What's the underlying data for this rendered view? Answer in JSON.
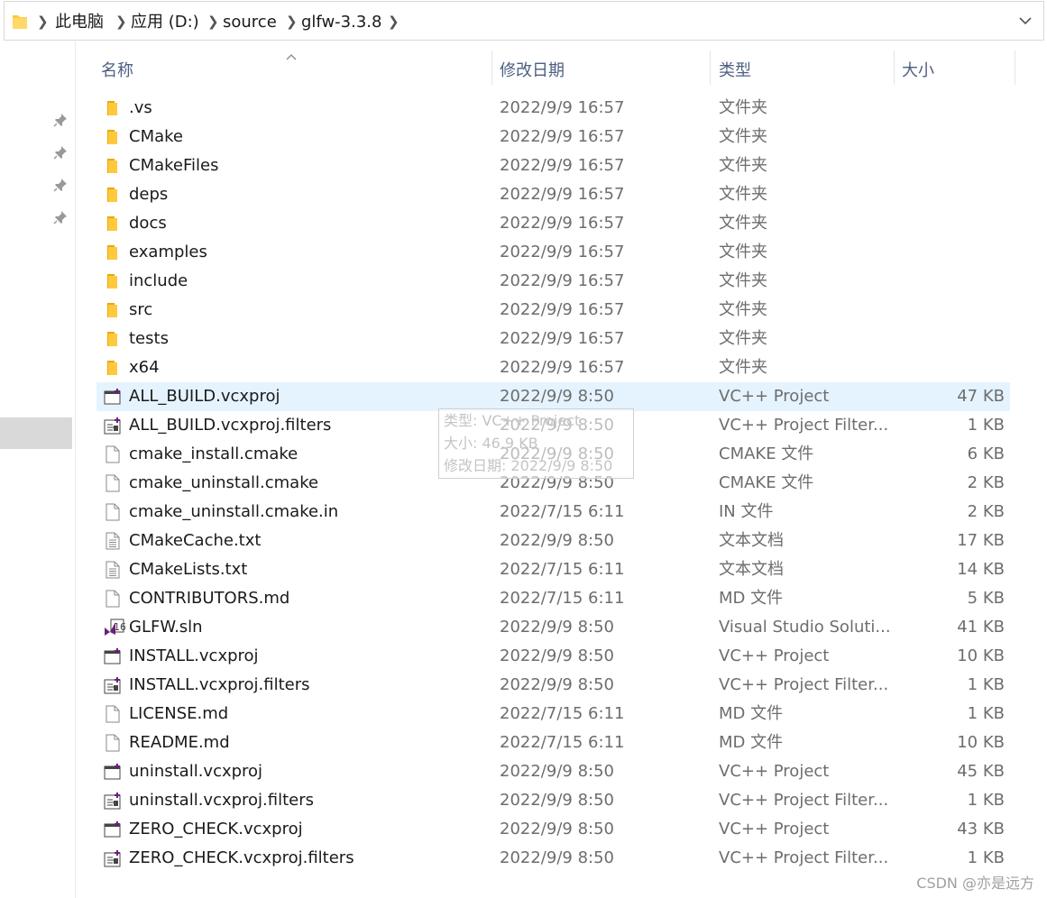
{
  "breadcrumb": [
    "此电脑",
    "应用 (D:)",
    "source",
    "glfw-3.3.8"
  ],
  "columns": {
    "name": "名称",
    "date": "修改日期",
    "type": "类型",
    "size": "大小"
  },
  "files": [
    {
      "name": ".vs",
      "date": "2022/9/9 16:57",
      "type": "文件夹",
      "size": "",
      "icon": "folder-icon"
    },
    {
      "name": "CMake",
      "date": "2022/9/9 16:57",
      "type": "文件夹",
      "size": "",
      "icon": "folder-icon"
    },
    {
      "name": "CMakeFiles",
      "date": "2022/9/9 16:57",
      "type": "文件夹",
      "size": "",
      "icon": "folder-icon"
    },
    {
      "name": "deps",
      "date": "2022/9/9 16:57",
      "type": "文件夹",
      "size": "",
      "icon": "folder-icon"
    },
    {
      "name": "docs",
      "date": "2022/9/9 16:57",
      "type": "文件夹",
      "size": "",
      "icon": "folder-icon"
    },
    {
      "name": "examples",
      "date": "2022/9/9 16:57",
      "type": "文件夹",
      "size": "",
      "icon": "folder-icon"
    },
    {
      "name": "include",
      "date": "2022/9/9 16:57",
      "type": "文件夹",
      "size": "",
      "icon": "folder-icon"
    },
    {
      "name": "src",
      "date": "2022/9/9 16:57",
      "type": "文件夹",
      "size": "",
      "icon": "folder-icon"
    },
    {
      "name": "tests",
      "date": "2022/9/9 16:57",
      "type": "文件夹",
      "size": "",
      "icon": "folder-icon"
    },
    {
      "name": "x64",
      "date": "2022/9/9 16:57",
      "type": "文件夹",
      "size": "",
      "icon": "folder-icon"
    },
    {
      "name": "ALL_BUILD.vcxproj",
      "date": "2022/9/9 8:50",
      "type": "VC++ Project",
      "size": "47 KB",
      "icon": "vcxproj-icon"
    },
    {
      "name": "ALL_BUILD.vcxproj.filters",
      "date": "2022/9/9 8:50",
      "type": "VC++ Project Filter...",
      "size": "1 KB",
      "icon": "filters-icon"
    },
    {
      "name": "cmake_install.cmake",
      "date": "2022/9/9 8:50",
      "type": "CMAKE 文件",
      "size": "6 KB",
      "icon": "file-icon"
    },
    {
      "name": "cmake_uninstall.cmake",
      "date": "2022/9/9 8:50",
      "type": "CMAKE 文件",
      "size": "2 KB",
      "icon": "file-icon"
    },
    {
      "name": "cmake_uninstall.cmake.in",
      "date": "2022/7/15 6:11",
      "type": "IN 文件",
      "size": "2 KB",
      "icon": "file-icon"
    },
    {
      "name": "CMakeCache.txt",
      "date": "2022/9/9 8:50",
      "type": "文本文档",
      "size": "17 KB",
      "icon": "text-file-icon"
    },
    {
      "name": "CMakeLists.txt",
      "date": "2022/7/15 6:11",
      "type": "文本文档",
      "size": "14 KB",
      "icon": "text-file-icon"
    },
    {
      "name": "CONTRIBUTORS.md",
      "date": "2022/7/15 6:11",
      "type": "MD 文件",
      "size": "5 KB",
      "icon": "file-icon"
    },
    {
      "name": "GLFW.sln",
      "date": "2022/9/9 8:50",
      "type": "Visual Studio Soluti...",
      "size": "41 KB",
      "icon": "sln-icon"
    },
    {
      "name": "INSTALL.vcxproj",
      "date": "2022/9/9 8:50",
      "type": "VC++ Project",
      "size": "10 KB",
      "icon": "vcxproj-icon"
    },
    {
      "name": "INSTALL.vcxproj.filters",
      "date": "2022/9/9 8:50",
      "type": "VC++ Project Filter...",
      "size": "1 KB",
      "icon": "filters-icon"
    },
    {
      "name": "LICENSE.md",
      "date": "2022/7/15 6:11",
      "type": "MD 文件",
      "size": "1 KB",
      "icon": "file-icon"
    },
    {
      "name": "README.md",
      "date": "2022/7/15 6:11",
      "type": "MD 文件",
      "size": "10 KB",
      "icon": "file-icon"
    },
    {
      "name": "uninstall.vcxproj",
      "date": "2022/9/9 8:50",
      "type": "VC++ Project",
      "size": "45 KB",
      "icon": "vcxproj-icon"
    },
    {
      "name": "uninstall.vcxproj.filters",
      "date": "2022/9/9 8:50",
      "type": "VC++ Project Filter...",
      "size": "1 KB",
      "icon": "filters-icon"
    },
    {
      "name": "ZERO_CHECK.vcxproj",
      "date": "2022/9/9 8:50",
      "type": "VC++ Project",
      "size": "43 KB",
      "icon": "vcxproj-icon"
    },
    {
      "name": "ZERO_CHECK.vcxproj.filters",
      "date": "2022/9/9 8:50",
      "type": "VC++ Project Filter...",
      "size": "1 KB",
      "icon": "filters-icon"
    }
  ],
  "hovered_index": 10,
  "tooltip": [
    "类型: VC++ Project",
    "大小: 46.9 KB",
    "修改日期: 2022/9/9 8:50"
  ],
  "watermark": "CSDN @亦是远方",
  "colors": {
    "folder": "#ffc83d",
    "hover": "#e5f3ff",
    "header_text": "#4d6082",
    "vs_purple": "#68217a"
  }
}
